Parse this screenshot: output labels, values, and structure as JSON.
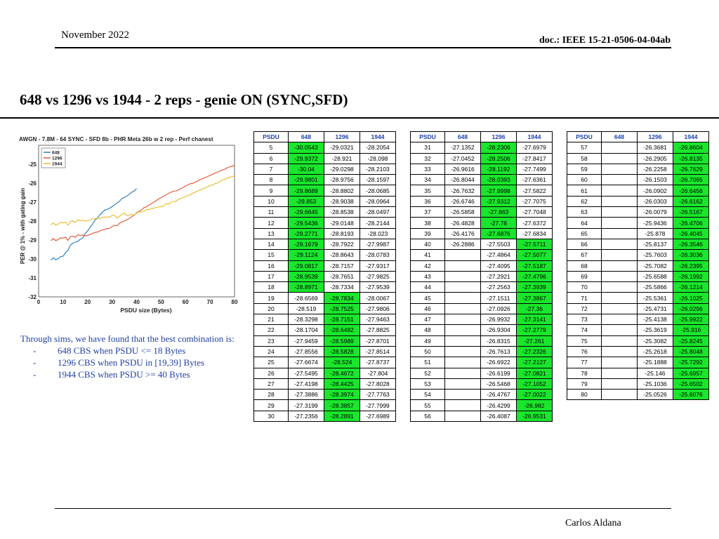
{
  "header": {
    "date": "November 2022",
    "doc": "doc.: IEEE 15-21-0506-04-04ab"
  },
  "slide": {
    "title": "648 vs 1296 vs 1944 - 2 reps - genie ON (SYNC,SFD)"
  },
  "footer": {
    "author": "Carlos Aldana"
  },
  "notes": {
    "intro": "Through sims, we have found that the best combination is:",
    "bullets": [
      "648 CBS when PSDU <= 18 Bytes",
      "1296 CBS when PSDU in [19,39] Bytes",
      "1944 CBS when PSDU >= 40 Bytes"
    ]
  },
  "table_headers": [
    "PSDU",
    "648",
    "1296",
    "1944"
  ],
  "tables": [
    {
      "rows": [
        [
          "5",
          "-30.0543",
          "-29.0321",
          "-28.2054",
          1
        ],
        [
          "6",
          "-29.9372",
          "-28.921",
          "-28.098",
          1
        ],
        [
          "7",
          "-30.04",
          "-29.0298",
          "-28.2103",
          1
        ],
        [
          "8",
          "-29.9801",
          "-28.9756",
          "-28.1597",
          1
        ],
        [
          "9",
          "-29.8689",
          "-28.8802",
          "-28.0685",
          1
        ],
        [
          "10",
          "-29.853",
          "-28.9038",
          "-28.0964",
          1
        ],
        [
          "11",
          "-29.6645",
          "-28.8538",
          "-28.0497",
          1
        ],
        [
          "12",
          "-29.5436",
          "-29.0148",
          "-28.2144",
          1
        ],
        [
          "13",
          "-29.2771",
          "-28.8193",
          "-28.023",
          1
        ],
        [
          "14",
          "-29.1679",
          "-28.7922",
          "-27.9987",
          1
        ],
        [
          "15",
          "-29.1124",
          "-28.8643",
          "-28.0783",
          1
        ],
        [
          "16",
          "-29.0817",
          "-28.7157",
          "-27.9317",
          1
        ],
        [
          "17",
          "-28.9539",
          "-28.7651",
          "-27.9825",
          1
        ],
        [
          "18",
          "-28.8971",
          "-28.7334",
          "-27.9539",
          1
        ],
        [
          "19",
          "-28.6569",
          "-28.7834",
          "-28.0067",
          2
        ],
        [
          "20",
          "-28.519",
          "-28.7525",
          "-27.9806",
          2
        ],
        [
          "21",
          "-28.3298",
          "-28.7151",
          "-27.9463",
          2
        ],
        [
          "22",
          "-28.1704",
          "-28.6482",
          "-27.8825",
          2
        ],
        [
          "23",
          "-27.9459",
          "-28.5989",
          "-27.8701",
          2
        ],
        [
          "24",
          "-27.8556",
          "-28.5828",
          "-27.8514",
          2
        ],
        [
          "25",
          "-27.6674",
          "-28.524",
          "-27.8737",
          2
        ],
        [
          "26",
          "-27.5495",
          "-28.4672",
          "-27.804",
          2
        ],
        [
          "27",
          "-27.4198",
          "-28.4425",
          "-27.8028",
          2
        ],
        [
          "28",
          "-27.3886",
          "-28.3974",
          "-27.7763",
          2
        ],
        [
          "29",
          "-27.3199",
          "-28.3857",
          "-27.7999",
          2
        ],
        [
          "30",
          "-27.2356",
          "-28.2891",
          "-27.6989",
          2
        ]
      ]
    },
    {
      "rows": [
        [
          "31",
          "-27.1352",
          "-28.2306",
          "-27.6979",
          2
        ],
        [
          "32",
          "-27.0452",
          "-28.2506",
          "-27.8417",
          2
        ],
        [
          "33",
          "-26.9616",
          "-28.1192",
          "-27.7499",
          2
        ],
        [
          "34",
          "-26.8044",
          "-28.0393",
          "-27.6361",
          2
        ],
        [
          "35",
          "-26.7632",
          "-27.9998",
          "-27.5822",
          2
        ],
        [
          "36",
          "-26.6746",
          "-27.9312",
          "-27.7075",
          2
        ],
        [
          "37",
          "-26.5858",
          "-27.863",
          "-27.7048",
          2
        ],
        [
          "38",
          "-26.4828",
          "-27.78",
          "-27.6372",
          2
        ],
        [
          "39",
          "-26.4176",
          "-27.6876",
          "-27.6834",
          2
        ],
        [
          "40",
          "-26.2886",
          "-27.5503",
          "-27.5711",
          3
        ],
        [
          "41",
          "",
          "-27.4864",
          "-27.5077",
          3
        ],
        [
          "42",
          "",
          "-27.4095",
          "-27.5187",
          3
        ],
        [
          "43",
          "",
          "-27.2921",
          "-27.4796",
          3
        ],
        [
          "44",
          "",
          "-27.2563",
          "-27.3939",
          3
        ],
        [
          "45",
          "",
          "-27.1511",
          "-27.3867",
          3
        ],
        [
          "46",
          "",
          "-27.0926",
          "-27.36",
          3
        ],
        [
          "47",
          "",
          "-26.9932",
          "-27.3141",
          3
        ],
        [
          "48",
          "",
          "-26.9304",
          "-27.2779",
          3
        ],
        [
          "49",
          "",
          "-26.8315",
          "-27.261",
          3
        ],
        [
          "50",
          "",
          "-26.7613",
          "-27.2326",
          3
        ],
        [
          "51",
          "",
          "-26.6922",
          "-27.2127",
          3
        ],
        [
          "52",
          "",
          "-26.6199",
          "-27.0821",
          3
        ],
        [
          "53",
          "",
          "-26.5468",
          "-27.1052",
          3
        ],
        [
          "54",
          "",
          "-26.4767",
          "-27.0022",
          3
        ],
        [
          "55",
          "",
          "-26.4299",
          "-26.982",
          3
        ],
        [
          "56",
          "",
          "-26.4087",
          "-26.9531",
          3
        ]
      ]
    },
    {
      "rows": [
        [
          "57",
          "",
          "-26.3681",
          "-26.8604",
          3
        ],
        [
          "58",
          "",
          "-26.2905",
          "-26.8135",
          3
        ],
        [
          "59",
          "",
          "-26.2258",
          "-26.7629",
          3
        ],
        [
          "60",
          "",
          "-26.1503",
          "-26.7065",
          3
        ],
        [
          "61",
          "",
          "-26.0902",
          "-26.6456",
          3
        ],
        [
          "62",
          "",
          "-26.0303",
          "-26.6162",
          3
        ],
        [
          "63",
          "",
          "-26.0079",
          "-26.5167",
          3
        ],
        [
          "64",
          "",
          "-25.9436",
          "-26.4706",
          3
        ],
        [
          "65",
          "",
          "-25.878",
          "-26.4045",
          3
        ],
        [
          "66",
          "",
          "-25.8137",
          "-26.3546",
          3
        ],
        [
          "67",
          "",
          "-25.7603",
          "-26.3036",
          3
        ],
        [
          "68",
          "",
          "-25.7082",
          "-26.2395",
          3
        ],
        [
          "69",
          "",
          "-25.6588",
          "-26.1992",
          3
        ],
        [
          "70",
          "",
          "-25.5866",
          "-26.1214",
          3
        ],
        [
          "71",
          "",
          "-25.5361",
          "-26.1025",
          3
        ],
        [
          "72",
          "",
          "-25.4731",
          "-26.0296",
          3
        ],
        [
          "73",
          "",
          "-25.4138",
          "-25.9922",
          3
        ],
        [
          "74",
          "",
          "-25.3619",
          "-25.916",
          3
        ],
        [
          "75",
          "",
          "-25.3082",
          "-25.8245",
          3
        ],
        [
          "76",
          "",
          "-25.2618",
          "-25.8048",
          3
        ],
        [
          "77",
          "",
          "-25.1888",
          "-25.7292",
          3
        ],
        [
          "78",
          "",
          "-25.146",
          "-25.6957",
          3
        ],
        [
          "79",
          "",
          "-25.1036",
          "-25.6502",
          3
        ],
        [
          "80",
          "",
          "-25.0526",
          "-25.6076",
          3
        ]
      ]
    }
  ],
  "chart_data": {
    "type": "line",
    "title": "AWGN - 7.8M - 64 SYNC - SFD 8b - PHR Meta 26b w 2 rep - Perf chanest",
    "xlabel": "PSDU size (Bytes)",
    "ylabel": "PER @ 1% - with gating gain",
    "xlim": [
      0,
      80
    ],
    "ylim": [
      -32,
      -24
    ],
    "xticks": [
      "0",
      "10",
      "20",
      "30",
      "40",
      "50",
      "60",
      "70",
      "80"
    ],
    "yticks": [
      "-25",
      "-26",
      "-27",
      "-28",
      "-29",
      "-30",
      "-31",
      "-32"
    ],
    "grid": true,
    "legend_position": "top-left",
    "series": [
      {
        "name": "648",
        "color": "#1f77c4",
        "x": [
          5,
          6,
          7,
          8,
          9,
          10,
          11,
          12,
          13,
          14,
          15,
          16,
          17,
          18,
          19,
          20,
          21,
          22,
          23,
          24,
          25,
          26,
          27,
          28,
          29,
          30,
          31,
          32,
          33,
          34,
          35,
          36,
          37,
          38,
          39,
          40
        ],
        "y": [
          -30.0543,
          -29.9372,
          -30.04,
          -29.9801,
          -29.8689,
          -29.853,
          -29.6645,
          -29.5436,
          -29.2771,
          -29.1679,
          -29.1124,
          -29.0817,
          -28.9539,
          -28.8971,
          -28.6569,
          -28.519,
          -28.3298,
          -28.1704,
          -27.9459,
          -27.8556,
          -27.6674,
          -27.5495,
          -27.4198,
          -27.3886,
          -27.3199,
          -27.2356,
          -27.1352,
          -27.0452,
          -26.9616,
          -26.8044,
          -26.7632,
          -26.6746,
          -26.5858,
          -26.4828,
          -26.4176,
          -26.2886
        ]
      },
      {
        "name": "1296",
        "color": "#e0502a",
        "x": [
          5,
          6,
          7,
          8,
          9,
          10,
          11,
          12,
          13,
          14,
          15,
          16,
          17,
          18,
          19,
          20,
          21,
          22,
          23,
          24,
          25,
          26,
          27,
          28,
          29,
          30,
          31,
          32,
          33,
          34,
          35,
          36,
          37,
          38,
          39,
          40,
          41,
          42,
          43,
          44,
          45,
          46,
          47,
          48,
          49,
          50,
          51,
          52,
          53,
          54,
          55,
          56,
          57,
          58,
          59,
          60,
          61,
          62,
          63,
          64,
          65,
          66,
          67,
          68,
          69,
          70,
          71,
          72,
          73,
          74,
          75,
          76,
          77,
          78,
          79,
          80
        ],
        "y": [
          -29.0321,
          -28.921,
          -29.0298,
          -28.9756,
          -28.8802,
          -28.9038,
          -28.8538,
          -29.0148,
          -28.8193,
          -28.7922,
          -28.8643,
          -28.7157,
          -28.7651,
          -28.7334,
          -28.7834,
          -28.7525,
          -28.7151,
          -28.6482,
          -28.5989,
          -28.5828,
          -28.524,
          -28.4672,
          -28.4425,
          -28.3974,
          -28.3857,
          -28.2891,
          -28.2306,
          -28.2506,
          -28.1192,
          -28.0393,
          -27.9998,
          -27.9312,
          -27.863,
          -27.78,
          -27.6876,
          -27.5503,
          -27.4864,
          -27.4095,
          -27.2921,
          -27.2563,
          -27.1511,
          -27.0926,
          -26.9932,
          -26.9304,
          -26.8315,
          -26.7613,
          -26.6922,
          -26.6199,
          -26.5468,
          -26.4767,
          -26.4299,
          -26.4087,
          -26.3681,
          -26.2905,
          -26.2258,
          -26.1503,
          -26.0902,
          -26.0303,
          -26.0079,
          -25.9436,
          -25.878,
          -25.8137,
          -25.7603,
          -25.7082,
          -25.6588,
          -25.5866,
          -25.5361,
          -25.4731,
          -25.4138,
          -25.3619,
          -25.3082,
          -25.2618,
          -25.1888,
          -25.146,
          -25.1036,
          -25.0526
        ]
      },
      {
        "name": "1944",
        "color": "#e8b820",
        "x": [
          5,
          6,
          7,
          8,
          9,
          10,
          11,
          12,
          13,
          14,
          15,
          16,
          17,
          18,
          19,
          20,
          21,
          22,
          23,
          24,
          25,
          26,
          27,
          28,
          29,
          30,
          31,
          32,
          33,
          34,
          35,
          36,
          37,
          38,
          39,
          40,
          41,
          42,
          43,
          44,
          45,
          46,
          47,
          48,
          49,
          50,
          51,
          52,
          53,
          54,
          55,
          56,
          57,
          58,
          59,
          60,
          61,
          62,
          63,
          64,
          65,
          66,
          67,
          68,
          69,
          70,
          71,
          72,
          73,
          74,
          75,
          76,
          77,
          78,
          79,
          80
        ],
        "y": [
          -28.2054,
          -28.098,
          -28.2103,
          -28.1597,
          -28.0685,
          -28.0964,
          -28.0497,
          -28.2144,
          -28.023,
          -27.9987,
          -28.0783,
          -27.9317,
          -27.9825,
          -27.9539,
          -28.0067,
          -27.9806,
          -27.9463,
          -27.8825,
          -27.8701,
          -27.8514,
          -27.8737,
          -27.804,
          -27.8028,
          -27.7763,
          -27.7999,
          -27.6989,
          -27.6979,
          -27.8417,
          -27.7499,
          -27.6361,
          -27.5822,
          -27.7075,
          -27.7048,
          -27.6372,
          -27.6834,
          -27.5711,
          -27.5077,
          -27.5187,
          -27.4796,
          -27.3939,
          -27.3867,
          -27.36,
          -27.3141,
          -27.2779,
          -27.261,
          -27.2326,
          -27.2127,
          -27.0821,
          -27.1052,
          -27.0022,
          -26.982,
          -26.9531,
          -26.8604,
          -26.8135,
          -26.7629,
          -26.7065,
          -26.6456,
          -26.6162,
          -26.5167,
          -26.4706,
          -26.4045,
          -26.3546,
          -26.3036,
          -26.2395,
          -26.1992,
          -26.1214,
          -26.1025,
          -26.0296,
          -25.9922,
          -25.916,
          -25.8245,
          -25.8048,
          -25.7292,
          -25.6957,
          -25.6502,
          -25.6076
        ]
      }
    ]
  }
}
